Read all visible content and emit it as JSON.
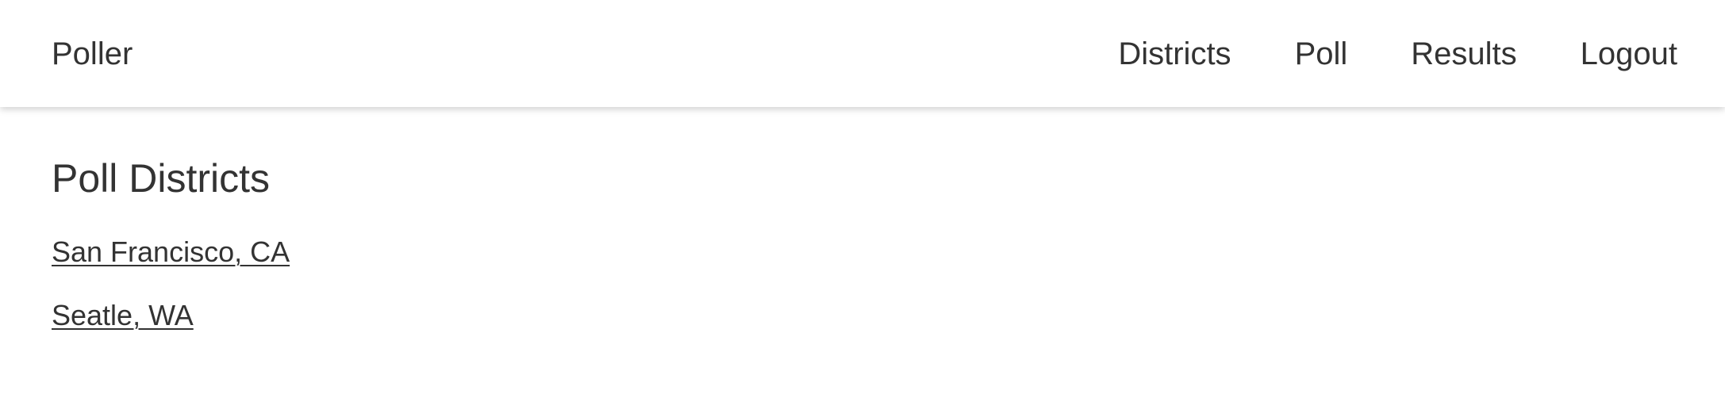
{
  "header": {
    "brand": "Poller",
    "nav": [
      {
        "label": "Districts"
      },
      {
        "label": "Poll"
      },
      {
        "label": "Results"
      },
      {
        "label": "Logout"
      }
    ]
  },
  "main": {
    "title": "Poll Districts",
    "districts": [
      {
        "label": "San Francisco, CA"
      },
      {
        "label": "Seatle, WA"
      }
    ]
  }
}
